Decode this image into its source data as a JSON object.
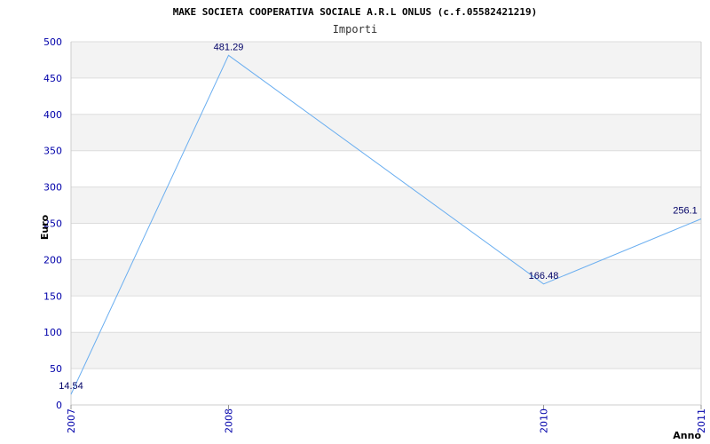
{
  "chart_data": {
    "type": "line",
    "title": "MAKE SOCIETA COOPERATIVA SOCIALE A.R.L ONLUS (c.f.05582421219)",
    "subtitle": "Importi",
    "xlabel": "Anno",
    "ylabel": "Euro",
    "x": [
      "2007",
      "2008",
      "2010",
      "2011"
    ],
    "x_numeric": [
      2007,
      2008,
      2010,
      2011
    ],
    "values": [
      14.54,
      481.29,
      166.48,
      256.1
    ],
    "data_labels": [
      "14.54",
      "481.29",
      "166.48",
      "256.1"
    ],
    "ylim": [
      0,
      500
    ],
    "yticks": [
      0,
      50,
      100,
      150,
      200,
      250,
      300,
      350,
      400,
      450,
      500
    ],
    "grid": true,
    "line_color": "#6aaef0",
    "band_color": "#f3f3f3",
    "tick_color": "#0000aa"
  }
}
